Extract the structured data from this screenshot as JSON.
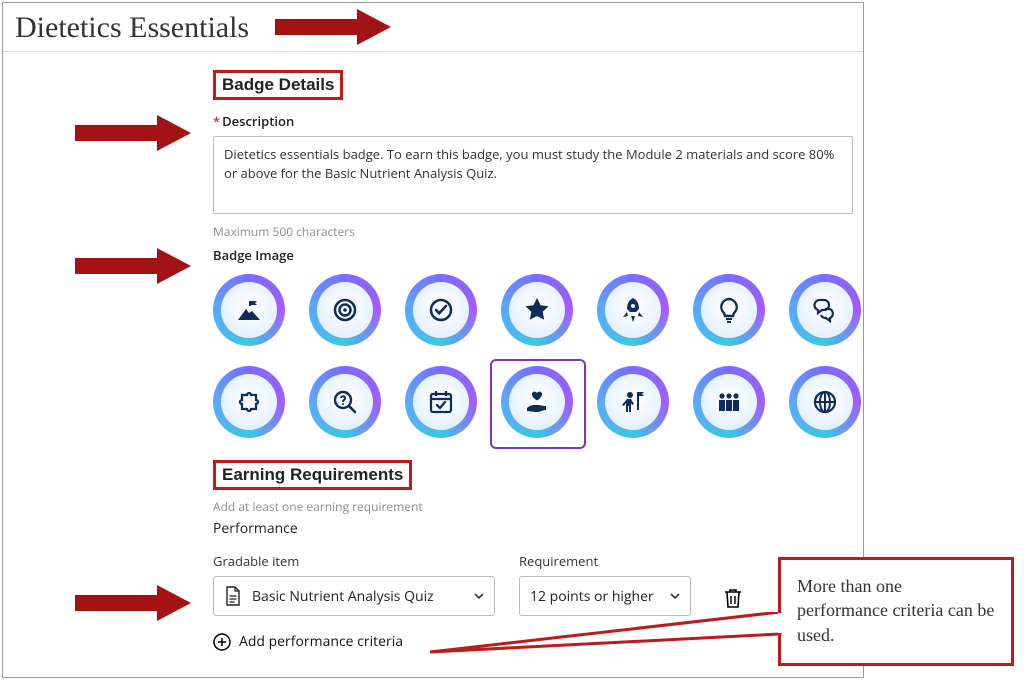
{
  "page_title": "Dietetics Essentials",
  "sections": {
    "badge_details": "Badge Details",
    "earning_requirements": "Earning Requirements"
  },
  "description": {
    "label": "Description",
    "required_marker": "*",
    "value": "Dietetics essentials badge. To earn this badge, you must study the Module 2 materials and score 80% or above for the Basic Nutrient Analysis Quiz.",
    "max_hint": "Maximum 500 characters"
  },
  "badge_image": {
    "label": "Badge Image",
    "icons": [
      "mountain-flag-icon",
      "target-icon",
      "checkmark-circle-icon",
      "star-icon",
      "rocket-icon",
      "lightbulb-icon",
      "chat-bubbles-icon",
      "puzzle-icon",
      "magnifier-question-icon",
      "calendar-check-icon",
      "heart-in-hand-icon",
      "person-flag-icon",
      "people-group-icon",
      "globe-icon"
    ],
    "selected_index": 10
  },
  "earning": {
    "hint": "Add at least one earning requirement",
    "performance_label": "Performance",
    "columns": {
      "gradable": "Gradable item",
      "requirement": "Requirement"
    },
    "gradable_value": "Basic Nutrient Analysis Quiz",
    "requirement_value": "12 points or higher",
    "add_label": "Add performance criteria"
  },
  "callout_text": "More than one performance criteria can be used."
}
